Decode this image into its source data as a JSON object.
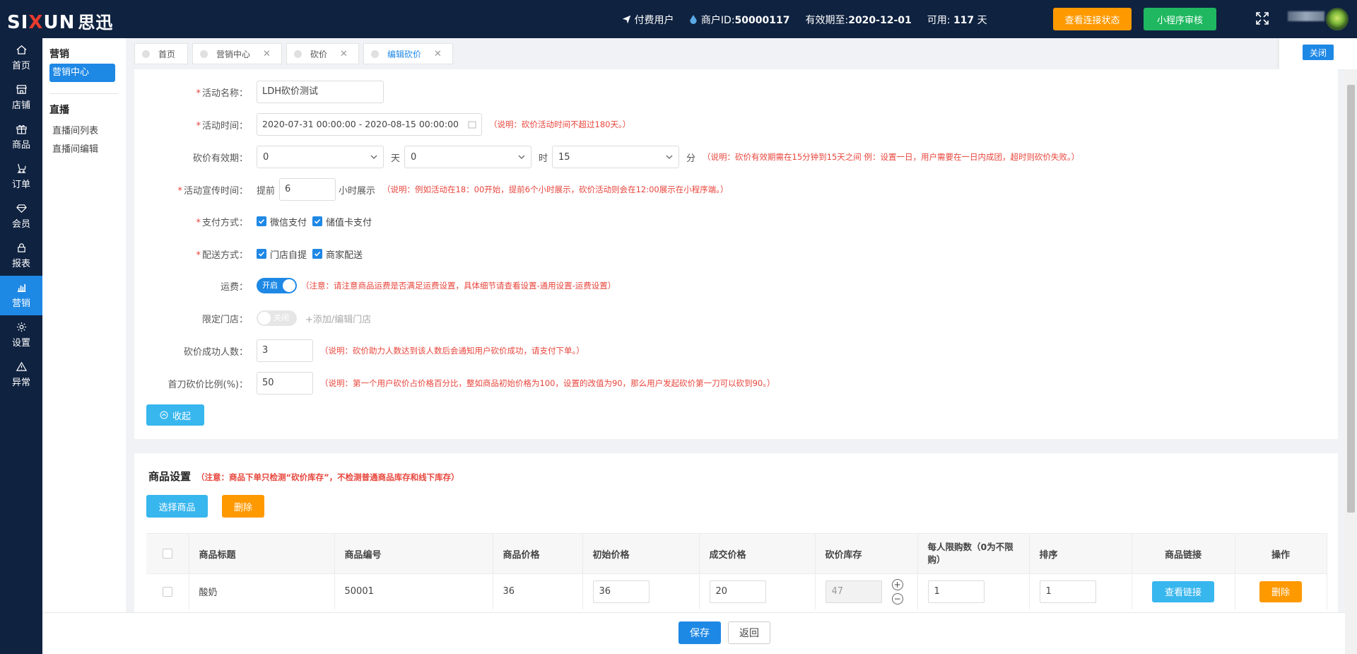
{
  "brand": {
    "logo_a": "SI",
    "logo_x": "X",
    "logo_b": "UN",
    "logo_cn": "思迅"
  },
  "topbar": {
    "user_type": "付费用户",
    "merchant_label": "商户ID:",
    "merchant_id": "50000117",
    "expire_label": "有效期至:",
    "expire_date": "2020-12-01",
    "available_label": "可用:",
    "available_days": "117",
    "days_unit": "天",
    "btn_status": "查看连接状态",
    "btn_review": "小程序审核"
  },
  "nav": [
    {
      "label": "首页",
      "icon": "home-icon"
    },
    {
      "label": "店铺",
      "icon": "store-icon"
    },
    {
      "label": "商品",
      "icon": "gift-icon"
    },
    {
      "label": "订单",
      "icon": "order-icon"
    },
    {
      "label": "会员",
      "icon": "diamond-icon"
    },
    {
      "label": "报表",
      "icon": "lock-icon"
    },
    {
      "label": "营销",
      "icon": "bar-chart-icon",
      "active": true
    },
    {
      "label": "设置",
      "icon": "gear-icon"
    },
    {
      "label": "异常",
      "icon": "warning-icon"
    }
  ],
  "subnav": {
    "section1": "营销",
    "active_item": "营销中心",
    "section2": "直播",
    "item1": "直播间列表",
    "item2": "直播间编辑"
  },
  "tabs": [
    {
      "label": "首页"
    },
    {
      "label": "营销中心"
    },
    {
      "label": "砍价"
    },
    {
      "label": "编辑砍价"
    }
  ],
  "close_label": "关闭",
  "form": {
    "name_label": "活动名称：",
    "name_value": "LDH砍价测试",
    "time_label": "活动时间：",
    "time_value": "2020-07-31 00:00:00 - 2020-08-15 00:00:00",
    "time_note": "（说明：砍价活动时间不超过180天。）",
    "valid_label": "砍价有效期：",
    "valid_day": "0",
    "day_unit": "天",
    "valid_hour": "0",
    "hour_unit": "时",
    "valid_min": "15",
    "min_unit": "分",
    "valid_note": "（说明：砍价有效期需在15分钟到15天之间 例：设置一日，用户需要在一日内成团，超时则砍价失败。）",
    "promo_label": "活动宣传时间：",
    "promo_prefix": "提前",
    "promo_value": "6",
    "promo_suffix": "小时展示",
    "promo_note": "（说明：例如活动在18：00开始，提前6个小时展示，砍价活动则会在12:00展示在小程序端。）",
    "pay_label": "支付方式：",
    "pay1": "微信支付",
    "pay2": "储值卡支付",
    "ship_label": "配送方式：",
    "ship1": "门店自提",
    "ship2": "商家配送",
    "freight_label": "运费：",
    "freight_toggle": "开启",
    "freight_note": "（注意：请注意商品运费是否满足运费设置，具体细节请查看设置-通用设置-运费设置）",
    "store_label": "限定门店：",
    "store_toggle": "关闭",
    "store_link": "+添加/编辑门店",
    "count_label": "砍价成功人数：",
    "count_value": "3",
    "count_note": "（说明：砍价助力人数达到该人数后会通知用户砍价成功，请支付下单。）",
    "ratio_label": "首刀砍价比例(%)：",
    "ratio_value": "50",
    "ratio_note": "（说明：第一个用户砍价占价格百分比，整如商品初始价格为100，设置的改值为90，那么用户发起砍价第一刀可以砍到90。）",
    "collapse_label": "收起"
  },
  "goods": {
    "title": "商品设置",
    "warn": "（注意：商品下单只检测“砍价库存”，不检测普通商品库存和线下库存）",
    "btn_pick": "选择商品",
    "btn_delete": "删除",
    "headers": [
      "商品标题",
      "商品编号",
      "商品价格",
      "初始价格",
      "成交价格",
      "砍价库存",
      "每人限购数（0为不限购）",
      "排序",
      "商品链接",
      "操作"
    ],
    "rows": [
      {
        "title": "酸奶",
        "code": "50001",
        "price": "36",
        "init": "36",
        "deal": "20",
        "stock": "47",
        "limit": "1",
        "sort": "1",
        "link_btn": "查看链接",
        "del_btn": "删除"
      }
    ]
  },
  "footer": {
    "save": "保存",
    "back": "返回"
  }
}
